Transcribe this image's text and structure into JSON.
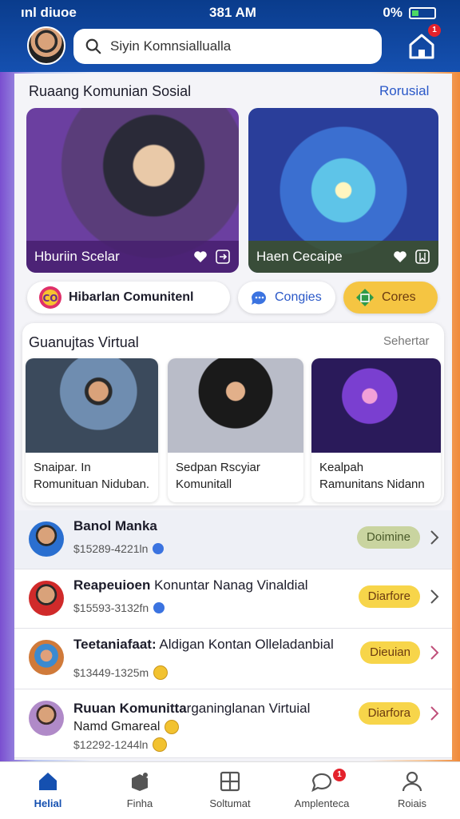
{
  "status": {
    "carrier": "ınl diuoe",
    "time": "381 AM",
    "battery": "0%"
  },
  "header": {
    "search_value": "Siyin Komnsiallualla",
    "home_badge": "1"
  },
  "section1": {
    "title": "Ruaang Komunian Sosial",
    "link": "Rorusial"
  },
  "feature_cards": [
    {
      "caption": "Hburiin Scelar"
    },
    {
      "caption": "Haen Cecaipe"
    }
  ],
  "pills": [
    {
      "label": "Hibarlan Comunitenl"
    },
    {
      "label": "Congies"
    },
    {
      "label": "Cores"
    }
  ],
  "section2": {
    "title": "Guanujtas Virtual",
    "link": "Sehertar"
  },
  "video_cards": [
    {
      "line1": "Snaipar. In",
      "line2": "Romunituan Niduban."
    },
    {
      "line1": "Sedpan Rscyiar",
      "line2": "Komunitall"
    },
    {
      "line1": "Kealpah",
      "line2": "Ramunitans Nidann"
    }
  ],
  "list": [
    {
      "name_bold": "Banol Manka",
      "name_rest": "",
      "name2": "",
      "sub": "$15289-4221ln",
      "tag": "Doimine",
      "tag_color": "#c9d4a0"
    },
    {
      "name_bold": "Reapeuioen",
      "name_rest": " Konuntar Nanag Vinaldial",
      "name2": "",
      "sub": "$15593-3132fn",
      "tag": "Diarfore",
      "tag_color": "#f7d54a"
    },
    {
      "name_bold": "Teetaniafaat:",
      "name_rest": " Aldigan Kontan Olleladanbial",
      "name2": "",
      "sub": "$13449-1325m",
      "tag": "Dieuian",
      "tag_color": "#f7d54a"
    },
    {
      "name_bold": "Ruuan Komunitta",
      "name_rest": "rganinglanan Virtuial",
      "name2": "Namd Gmareal",
      "sub": "$12292-1244ln",
      "tag": "Diarfora",
      "tag_color": "#f7d54a"
    }
  ],
  "tabs": [
    {
      "label": "Helial"
    },
    {
      "label": "Finha"
    },
    {
      "label": "Soltumat"
    },
    {
      "label": "Amplenteca",
      "badge": "1"
    },
    {
      "label": "Roiais"
    }
  ]
}
